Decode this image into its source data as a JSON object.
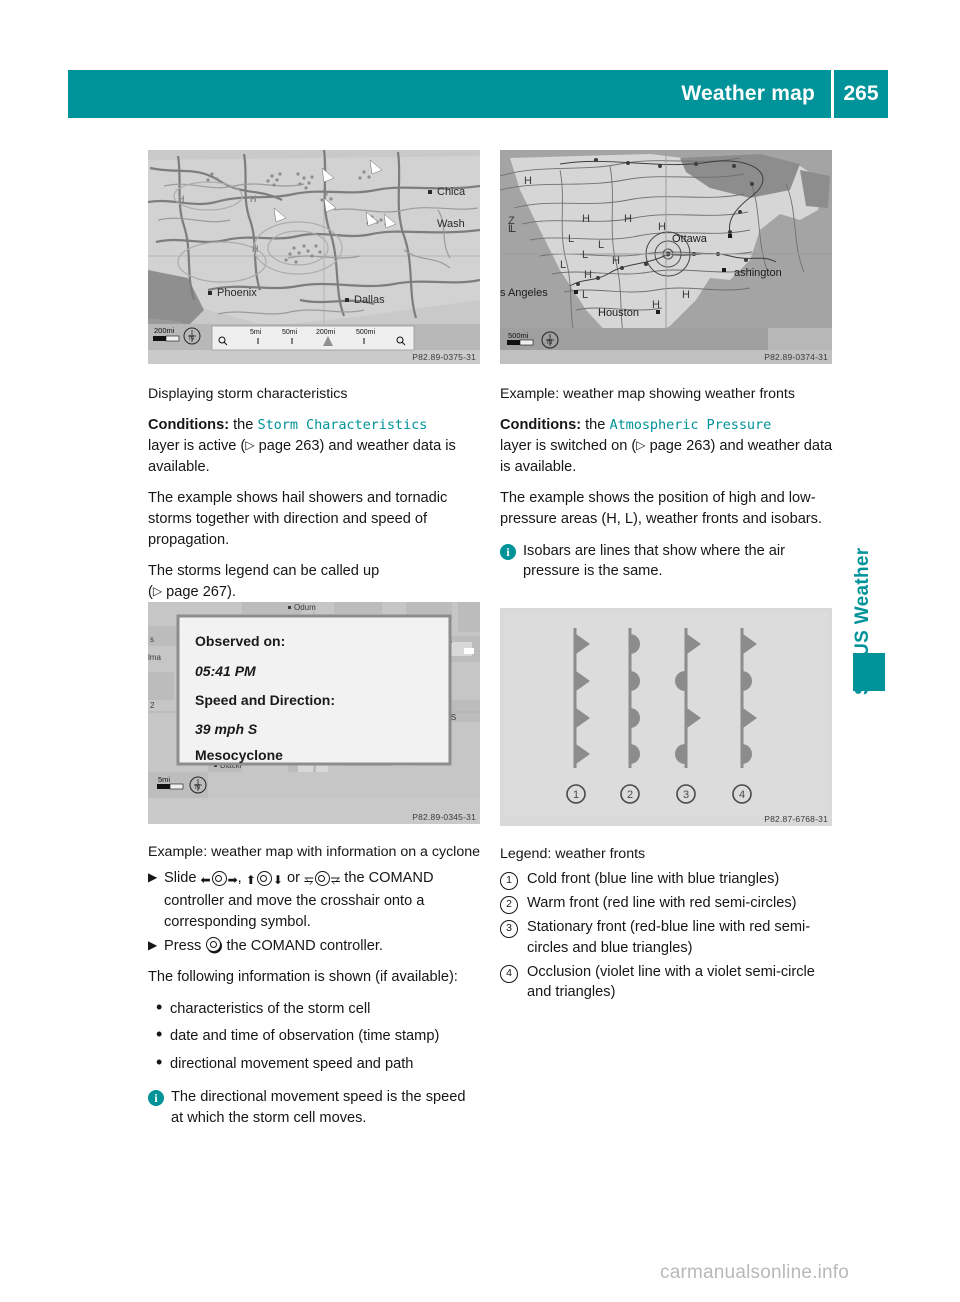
{
  "header": {
    "title": "Weather map",
    "page_number": "265"
  },
  "side_tab": {
    "label": "SIRIUS Weather"
  },
  "watermark": "carmanualsonline.info",
  "figures": {
    "storm_map": {
      "code": "P82.89-0375-31",
      "scale_label": "200mi",
      "zoom_steps": [
        "5mi",
        "50mi",
        "200mi",
        "500mi"
      ],
      "city_labels": [
        "Phoenix",
        "Dallas",
        "Chica",
        "Wash"
      ]
    },
    "pressure_map": {
      "code": "P82.89-0374-31",
      "scale_label": "500mi",
      "city_labels": [
        "s Angeles",
        "Houston",
        "Ottawa",
        "ashington"
      ],
      "pressure_markers": [
        "H",
        "L"
      ]
    },
    "cyclone_map": {
      "code": "P82.89-0345-31",
      "scale_label": "5mi",
      "popup": {
        "observed_label": "Observed on:",
        "observed_value": "05:41 PM",
        "speed_label": "Speed and Direction:",
        "speed_value": "39 mph S",
        "type_value": "Mesocyclone"
      },
      "poi_labels": [
        "Odum",
        "Blackl"
      ]
    },
    "fronts_diagram": {
      "code": "P82.87-6768-31",
      "numbers": [
        "1",
        "2",
        "3",
        "4"
      ]
    }
  },
  "left_column": {
    "fig_caption": "Displaying storm characteristics",
    "conditions_label": "Conditions:",
    "conditions_the": "the",
    "conditions_layer": "Storm Characteristics",
    "conditions_rest_a": "layer is active (",
    "conditions_ref": "page 263",
    "conditions_rest_b": ") and weather data is available.",
    "para_example": "The example shows hail showers and tornadic storms together with direction and speed of propagation.",
    "para_legend_a": "The storms legend can be called up",
    "para_legend_ref": "page 267",
    "para_legend_b": ").",
    "fig2_caption": "Example: weather map with information on a cyclone",
    "step1_a": "Slide",
    "step1_b": ",",
    "step1_c": "or",
    "step1_d": "the COMAND controller and move the crosshair onto a corresponding symbol.",
    "step2_a": "Press",
    "step2_b": "the COMAND controller.",
    "para_following": "The following information is shown (if available):",
    "bullets": [
      "characteristics of the storm cell",
      "date and time of observation (time stamp)",
      "directional movement speed and path"
    ],
    "note": "The directional movement speed is the speed at which the storm cell moves."
  },
  "right_column": {
    "fig_caption": "Example: weather map showing weather fronts",
    "conditions_label": "Conditions:",
    "conditions_the": "the",
    "conditions_layer": "Atmospheric Pressure",
    "conditions_rest_a": "layer is switched on (",
    "conditions_ref": "page 263",
    "conditions_rest_b": ") and weather data is available.",
    "para_example": "The example shows the position of high and low-pressure areas (H, L), weather fronts and isobars.",
    "note": "Isobars are lines that show where the air pressure is the same.",
    "legend_title": "Legend: weather fronts",
    "legend_items": [
      {
        "num": "1",
        "text": "Cold front (blue line with blue triangles)"
      },
      {
        "num": "2",
        "text": "Warm front (red line with red semi-circles)"
      },
      {
        "num": "3",
        "text": "Stationary front (red-blue line with red semi-circles and blue triangles)"
      },
      {
        "num": "4",
        "text": "Occlusion (violet line with a violet semi-circle and triangles)"
      }
    ]
  },
  "colors": {
    "accent_teal": "#009399",
    "text": "#161616",
    "watermark_grey": "#b9b9b9"
  }
}
